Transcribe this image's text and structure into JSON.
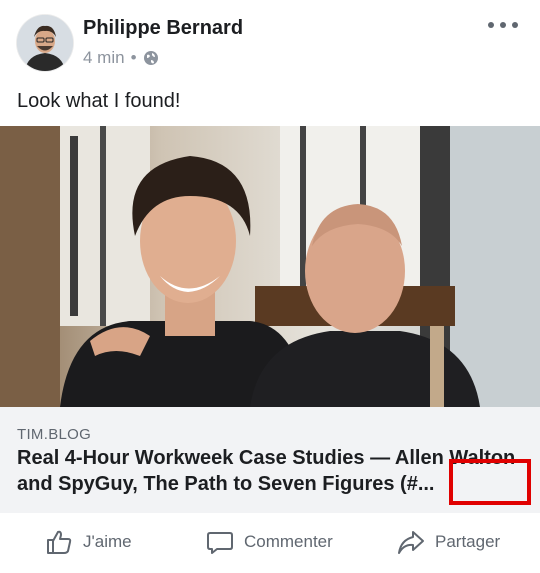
{
  "post": {
    "author": "Philippe Bernard",
    "time": "4 min",
    "separator": "•",
    "privacy_icon": "globe-icon",
    "more_icon": "more-dots-icon",
    "text": "Look what I found!"
  },
  "link_preview": {
    "domain": "TIM.BLOG",
    "title": "Real 4-Hour Workweek Case Studies — Allen Walton and SpyGuy, The Path to Seven Figures (#..."
  },
  "actions": {
    "like": "J'aime",
    "comment": "Commenter",
    "share": "Partager"
  },
  "colors": {
    "highlight": "#e00000",
    "link_bg": "#f2f3f5",
    "meta_text": "#8d949e",
    "action_text": "#606770"
  }
}
